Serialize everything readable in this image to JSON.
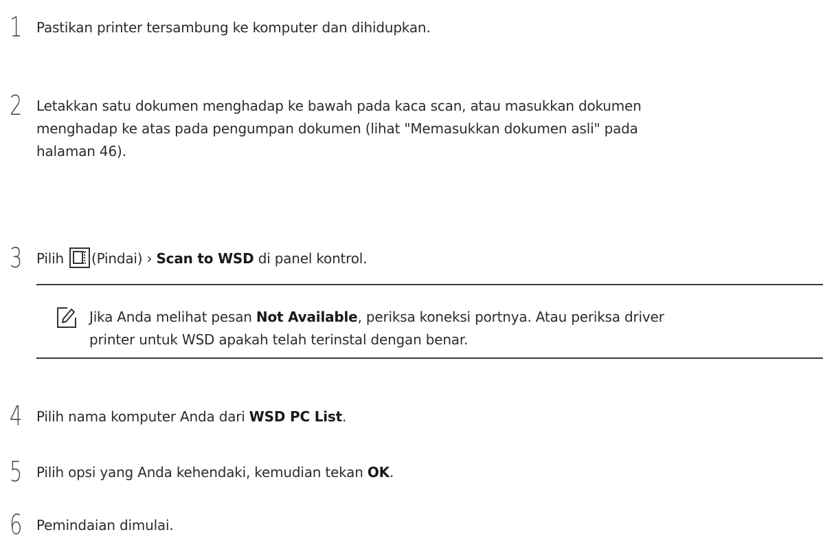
{
  "steps": [
    {
      "number": "1",
      "text": "Pastikan printer tersambung ke komputer dan dihidupkan."
    },
    {
      "number": "2",
      "line1": "Letakkan satu dokumen menghadap ke bawah pada kaca scan, atau masukkan dokumen",
      "line2": "menghadap ke atas pada pengumpan dokumen (lihat \"Memasukkan dokumen asli\" pada",
      "line3": "halaman 46)."
    },
    {
      "number": "3",
      "before": "Pilih",
      "icon": "scan-icon",
      "paren": "(Pindai) › ",
      "bold": "Scan to WSD",
      "after": " di panel kontrol."
    },
    {
      "number": "4",
      "before": "Pilih nama komputer Anda dari ",
      "bold": "WSD PC List",
      "after": "."
    },
    {
      "number": "5",
      "before": "Pilih opsi yang Anda kehendaki, kemudian tekan ",
      "bold": "OK",
      "after": "."
    },
    {
      "number": "6",
      "text": "Pemindaian dimulai."
    }
  ],
  "note": {
    "icon": "pencil-note-icon",
    "before": "Jika Anda melihat pesan ",
    "bold": "Not Available",
    "after": ", periksa koneksi portnya. Atau periksa driver",
    "line2": "printer untuk WSD apakah telah terinstal dengan benar."
  }
}
